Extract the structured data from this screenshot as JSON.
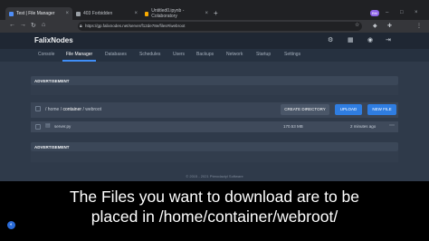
{
  "browser": {
    "tabs": [
      {
        "label": "Test | File Manager",
        "active": true
      },
      {
        "label": "403 Forbidden",
        "active": false
      },
      {
        "label": "Untitled0.ipynb - Colaboratory",
        "active": false
      }
    ],
    "new_tab": "+",
    "url": "https://gp.falixnodes.net/server/f12de78e/files#/webroot",
    "profile_initials": "BM"
  },
  "app": {
    "brand": "FalixNodes",
    "nav_tabs": [
      "Console",
      "File Manager",
      "Databases",
      "Schedules",
      "Users",
      "Backups",
      "Network",
      "Startup",
      "Settings"
    ],
    "active_tab": "File Manager",
    "ad_top_title": "ADVERTISEMENT",
    "ad_bottom_title": "ADVERTISEMENT",
    "breadcrumb": {
      "sep": "/",
      "home": "home",
      "container": "container",
      "webroot": "webroot"
    },
    "buttons": {
      "create_directory": "CREATE DIRECTORY",
      "upload": "UPLOAD",
      "new_file": "NEW FILE"
    },
    "files": [
      {
        "name": "server.py",
        "size": "170.53 MB",
        "modified": "2 minutes ago"
      }
    ],
    "footer": "© 2015 - 2021 Pterodactyl Software"
  },
  "caption": {
    "line1": "The Files you want to download are to be",
    "line2": "placed in /home/container/webroot/"
  },
  "colors": {
    "accent": "#3f8ef7",
    "button": "#2f7de1"
  }
}
